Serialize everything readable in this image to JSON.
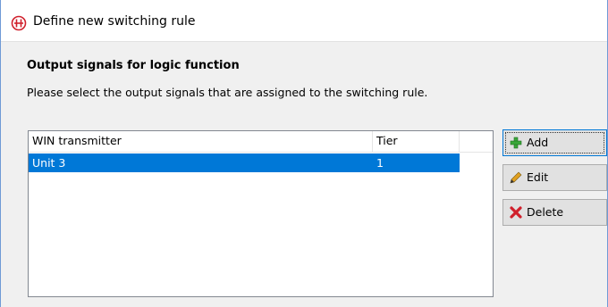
{
  "window": {
    "title": "Define new switching rule",
    "icon": "app-logo-icon"
  },
  "page": {
    "heading": "Output signals for logic function",
    "description": "Please select the output signals that are assigned to the switching rule."
  },
  "table": {
    "columns": [
      "WIN transmitter",
      "Tier",
      ""
    ],
    "rows": [
      {
        "transmitter": "Unit 3",
        "tier": "1",
        "selected": true
      }
    ]
  },
  "buttons": {
    "add": {
      "label": "Add",
      "icon": "plus-icon"
    },
    "edit": {
      "label": "Edit",
      "icon": "pencil-icon"
    },
    "delete": {
      "label": "Delete",
      "icon": "delete-x-icon"
    }
  },
  "colors": {
    "selection": "#0078d7",
    "accent_red": "#d0202c"
  }
}
